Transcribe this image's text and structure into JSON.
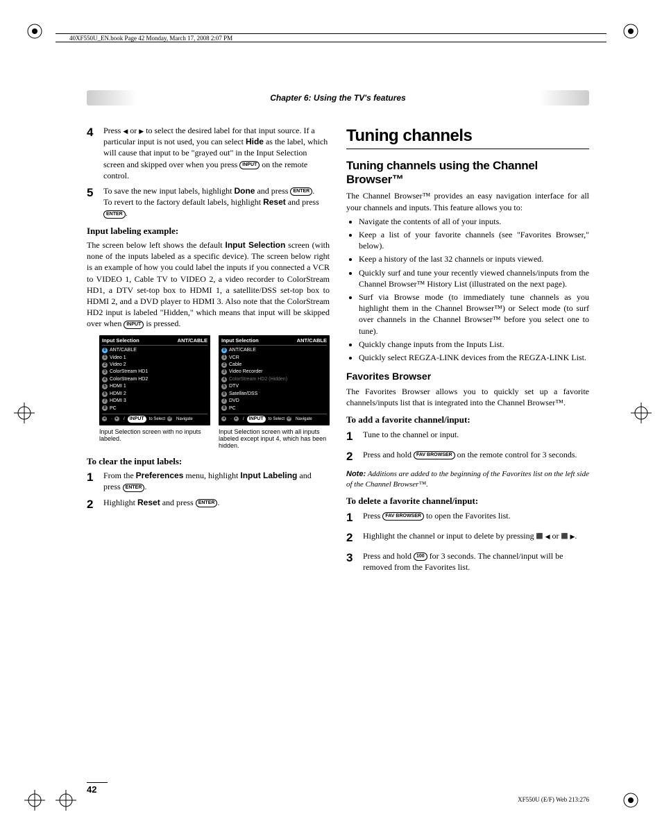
{
  "meta": {
    "book_line": "40XF550U_EN.book  Page 42  Monday, March 17, 2008  2:07 PM"
  },
  "chapter_banner": "Chapter 6: Using the TV's features",
  "left": {
    "step4": {
      "num": "4",
      "t1": "Press ",
      "t2": " or ",
      "t3": " to select the desired label for that input source. If a particular input is not used, you can select ",
      "hide": "Hide",
      "t4": " as the label, which will cause that input to be \"grayed out\" in the Input Selection screen and skipped over when you press ",
      "input_btn": "INPUT",
      "t5": " on the remote control."
    },
    "step5": {
      "num": "5",
      "t1": "To save the new input labels, highlight ",
      "done": "Done",
      "t2": " and press ",
      "enter_btn": "ENTER",
      "t3": ".",
      "t4": "To revert to the factory default labels, highlight ",
      "reset": "Reset",
      "t5": " and press ",
      "t6": "."
    },
    "example_heading": "Input labeling example:",
    "example_para_a": "The screen below left shows the default ",
    "example_bold": "Input Selection",
    "example_para_b": " screen (with none of the inputs labeled as a specific device). The screen below right is an example of how you could label the inputs if you connected a VCR to VIDEO 1, Cable TV to VIDEO 2, a video recorder to ColorStream HD1, a DTV set-top box to HDMI 1, a satellite/DSS set-top box to HDMI 2, and a DVD player to HDMI 3. Also note that the ColorStream HD2 input is labeled \"Hidden,\" which means that input will be skipped over when ",
    "example_btn": "INPUT",
    "example_para_c": " is pressed.",
    "screen_left": {
      "title": "Input Selection",
      "right": "ANT/CABLE",
      "items": [
        {
          "n": "0",
          "label": "ANT/CABLE",
          "sel": true
        },
        {
          "n": "1",
          "label": "Video 1"
        },
        {
          "n": "2",
          "label": "Video 2"
        },
        {
          "n": "3",
          "label": "ColorStream HD1"
        },
        {
          "n": "4",
          "label": "ColorStream HD2"
        },
        {
          "n": "5",
          "label": "HDMI 1"
        },
        {
          "n": "6",
          "label": "HDMI 2"
        },
        {
          "n": "7",
          "label": "HDMI 3"
        },
        {
          "n": "8",
          "label": "PC"
        }
      ],
      "foot_input": "INPUT",
      "foot_select": "to Select",
      "foot_nav": "Navigate"
    },
    "screen_right": {
      "title": "Input Selection",
      "right": "ANT/CABLE",
      "items": [
        {
          "n": "0",
          "label": "ANT/CABLE",
          "sel": true
        },
        {
          "n": "1",
          "label": "VCR"
        },
        {
          "n": "2",
          "label": "Cable"
        },
        {
          "n": "3",
          "label": "Video Recorder"
        },
        {
          "n": "4",
          "label": "ColorStream HD2 (Hidden)",
          "hidden": true
        },
        {
          "n": "5",
          "label": "DTV"
        },
        {
          "n": "6",
          "label": "Satellite/DSS"
        },
        {
          "n": "7",
          "label": "DVD"
        },
        {
          "n": "8",
          "label": "PC"
        }
      ],
      "foot_input": "INPUT",
      "foot_select": "to Select",
      "foot_nav": "Navigate"
    },
    "caption_left": "Input Selection screen with no inputs labeled.",
    "caption_right": "Input Selection screen with all inputs labeled except input 4, which has been hidden.",
    "clear_heading": "To clear the input labels:",
    "clear1": {
      "num": "1",
      "a": "From the ",
      "pref": "Preferences",
      "b": " menu, highlight ",
      "il": "Input Labeling",
      "c": " and press ",
      "enter": "ENTER",
      "d": "."
    },
    "clear2": {
      "num": "2",
      "a": "Highlight ",
      "reset": "Reset",
      "b": " and press ",
      "enter": "ENTER",
      "c": "."
    }
  },
  "right": {
    "h1": "Tuning channels",
    "h2": "Tuning channels using the Channel Browser™",
    "intro": "The Channel Browser™ provides an easy navigation interface for all your channels and inputs. This feature allows you to:",
    "bullets": [
      "Navigate the contents of all of your inputs.",
      "Keep a list of your favorite channels (see \"Favorites Browser,\" below).",
      "Keep a history of the last 32 channels or inputs viewed.",
      "Quickly surf and tune your recently viewed channels/inputs from the Channel Browser™ History List (illustrated on the next page).",
      "Surf via Browse mode (to immediately tune channels as you highlight them in the Channel Browser™) or Select mode (to surf over channels in the Channel Browser™ before you select one to tune).",
      "Quickly change inputs from the Inputs List.",
      "Quickly select REGZA-LINK devices from the REGZA-LINK List."
    ],
    "fav_h": "Favorites Browser",
    "fav_p": "The Favorites Browser allows you to quickly set up a favorite channels/inputs list that is integrated into the Channel Browser™.",
    "add_h": "To add a favorite channel/input:",
    "add1": {
      "num": "1",
      "t": "Tune to the channel or input."
    },
    "add2": {
      "num": "2",
      "a": "Press and hold ",
      "btn": "FAV BROWSER",
      "b": " on the remote control for 3 seconds."
    },
    "note_label": "Note:",
    "note_text": " Additions are added to the beginning of the Favorites list on the left side of the Channel Browser™.",
    "del_h": "To delete a favorite channel/input:",
    "del1": {
      "num": "1",
      "a": "Press ",
      "btn": "FAV BROWSER",
      "b": " to open the Favorites list."
    },
    "del2": {
      "num": "2",
      "a": "Highlight the channel or input to delete by pressing ",
      "b": " or ",
      "c": "."
    },
    "del3": {
      "num": "3",
      "a": "Press and hold ",
      "btn": "100",
      "b": " for 3 seconds. The channel/input will be removed from the Favorites list."
    }
  },
  "footer": {
    "page": "42",
    "right": "XF550U (E/F) Web 213:276"
  }
}
